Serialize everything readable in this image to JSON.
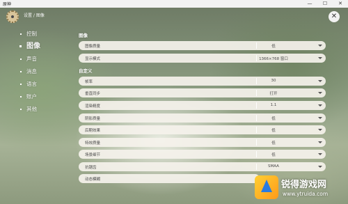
{
  "window": {
    "title": "原神",
    "minimize": "—",
    "maximize": "☐",
    "close": "✕"
  },
  "header": {
    "breadcrumb": "设置 / 图像",
    "close_icon": "✕"
  },
  "nav": {
    "items": [
      {
        "label": "控制",
        "active": false
      },
      {
        "label": "图像",
        "active": true
      },
      {
        "label": "声音",
        "active": false
      },
      {
        "label": "消息",
        "active": false
      },
      {
        "label": "语言",
        "active": false
      },
      {
        "label": "账户",
        "active": false
      },
      {
        "label": "其他",
        "active": false
      }
    ]
  },
  "image_section": {
    "title": "图像",
    "rows": [
      {
        "label": "图像质量",
        "value": "低"
      },
      {
        "label": "显示模式",
        "value": "1366×768 窗口"
      }
    ]
  },
  "custom_section": {
    "title": "自定义",
    "rows": [
      {
        "label": "帧率",
        "value": "30"
      },
      {
        "label": "垂直同步",
        "value": "打开"
      },
      {
        "label": "渲染精度",
        "value": "1.1"
      },
      {
        "label": "阴影质量",
        "value": "低"
      },
      {
        "label": "后期效果",
        "value": "低"
      },
      {
        "label": "特效质量",
        "value": "低"
      },
      {
        "label": "场景细节",
        "value": "低"
      },
      {
        "label": "抗锯齿",
        "value": "SMAA"
      },
      {
        "label": "动态模糊",
        "value": ""
      }
    ]
  },
  "watermark": {
    "title": "锐得游戏网",
    "url": "www.ytruida.com"
  }
}
